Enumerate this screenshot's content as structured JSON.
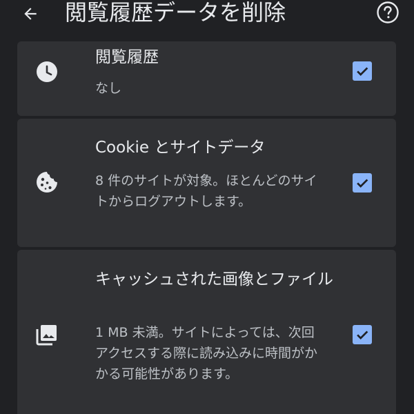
{
  "appbar": {
    "title": "閲覧履歴データを削除",
    "back_icon": "arrow-back-icon",
    "help_icon": "help-circle-icon"
  },
  "options": [
    {
      "title": "閲覧履歴",
      "description": "なし",
      "icon": "clock-icon",
      "checked": true
    },
    {
      "title": "Cookie とサイトデータ",
      "description": "8 件のサイトが対象。ほとんどのサイトからログアウトします。",
      "icon": "cookie-icon",
      "checked": true
    },
    {
      "title": "キャッシュされた画像とファイル",
      "description": "1 MB 未満。サイトによっては、次回アクセスする際に読み込みに時間がかかる可能性があります。",
      "icon": "image-icon",
      "checked": true
    }
  ],
  "colors": {
    "background": "#202124",
    "card": "#303134",
    "checkbox": "#8ab4f8",
    "text_primary": "#e8eaed",
    "text_secondary": "#bdc1c6"
  }
}
